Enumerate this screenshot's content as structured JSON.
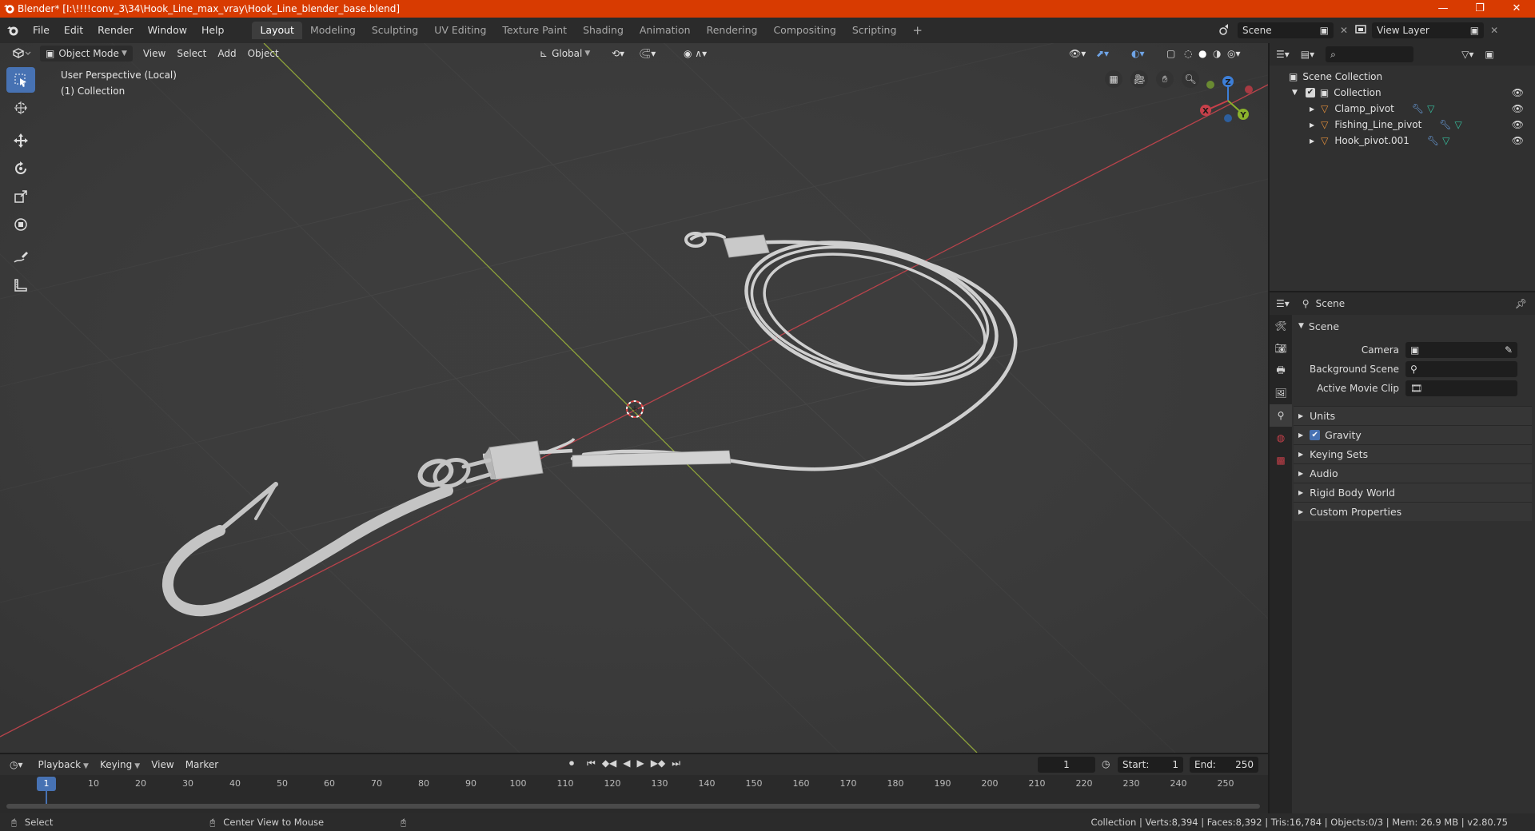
{
  "window": {
    "title": "Blender* [I:\\!!!!conv_3\\34\\Hook_Line_max_vray\\Hook_Line_blender_base.blend]",
    "minimize": "—",
    "maximize": "❐",
    "close": "✕"
  },
  "menu": [
    "File",
    "Edit",
    "Render",
    "Window",
    "Help"
  ],
  "workspaces": [
    "Layout",
    "Modeling",
    "Sculpting",
    "UV Editing",
    "Texture Paint",
    "Shading",
    "Animation",
    "Rendering",
    "Compositing",
    "Scripting"
  ],
  "workspace_add": "+",
  "scene_field": "Scene",
  "view_layer_field": "View Layer",
  "viewport": {
    "mode": "Object Mode",
    "menus": [
      "View",
      "Select",
      "Add",
      "Object"
    ],
    "orientation": "Global",
    "info_line1": "User Perspective (Local)",
    "info_line2": "(1) Collection",
    "gizmo": {
      "x": "X",
      "y": "Y",
      "z": "Z"
    }
  },
  "outliner": {
    "root": "Scene Collection",
    "collection": "Collection",
    "objects": [
      "Clamp_pivot",
      "Fishing_Line_pivot",
      "Hook_pivot.001"
    ]
  },
  "properties": {
    "header": "Scene",
    "panel_title": "Scene",
    "camera_label": "Camera",
    "background_scene_label": "Background Scene",
    "active_movie_clip_label": "Active Movie Clip",
    "subpanels": [
      "Units",
      "Gravity",
      "Keying Sets",
      "Audio",
      "Rigid Body World",
      "Custom Properties"
    ]
  },
  "timeline": {
    "menus": [
      "Playback",
      "Keying",
      "View",
      "Marker"
    ],
    "current_frame": "1",
    "start_label": "Start:",
    "start_value": "1",
    "end_label": "End:",
    "end_value": "250",
    "ruler_current": "1",
    "ruler_ticks": [
      "10",
      "20",
      "30",
      "40",
      "50",
      "60",
      "70",
      "80",
      "90",
      "100",
      "110",
      "120",
      "130",
      "140",
      "150",
      "160",
      "170",
      "180",
      "190",
      "200",
      "210",
      "220",
      "230",
      "240",
      "250"
    ]
  },
  "status": {
    "left_action": "Select",
    "middle_action": "Center View to Mouse",
    "stats": "Collection | Verts:8,394 | Faces:8,392 | Tris:16,784 | Objects:0/3 | Mem: 26.9 MB | v2.80.75"
  },
  "colors": {
    "title_bar": "#d83b01",
    "active_tool": "#4772b3",
    "x_axis": "#c8404a",
    "y_axis": "#8bb22c",
    "z_axis": "#3d7fd8",
    "object_icon": "#e8913a",
    "modifier_icon": "#6aa0e0",
    "mesh_icon": "#36c2a0"
  }
}
